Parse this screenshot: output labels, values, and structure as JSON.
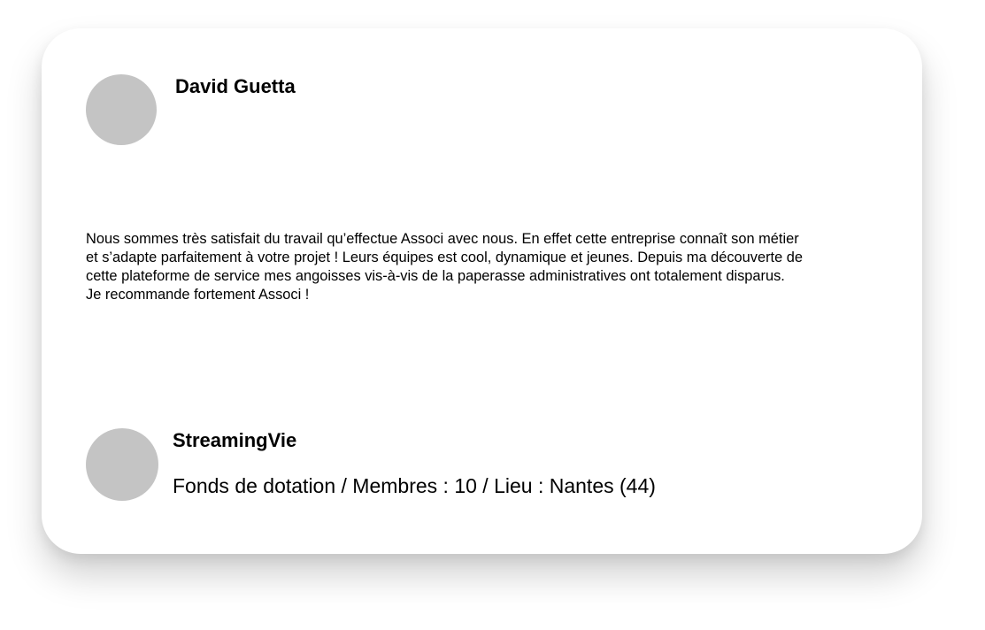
{
  "testimonial_card": {
    "author": {
      "name": "David Guetta",
      "avatar_color": "#c4c4c4"
    },
    "lines": [
      "Nous sommes très satisfait du travail qu’effectue Associ avec nous. En effet cette entreprise connaît son métier",
      "et s’adapte parfaitement à votre projet ! Leurs équipes est cool, dynamique et jeunes. Depuis ma découverte de",
      "cette plateforme de service mes angoisses vis-à-vis de la paperasse administratives ont totalement disparus.",
      "Je recommande fortement Associ !"
    ],
    "organization": {
      "name": "StreamingVie",
      "details": "Fonds de dotation / Membres : 10 / Lieu : Nantes (44)",
      "avatar_color": "#c4c4c4"
    }
  }
}
